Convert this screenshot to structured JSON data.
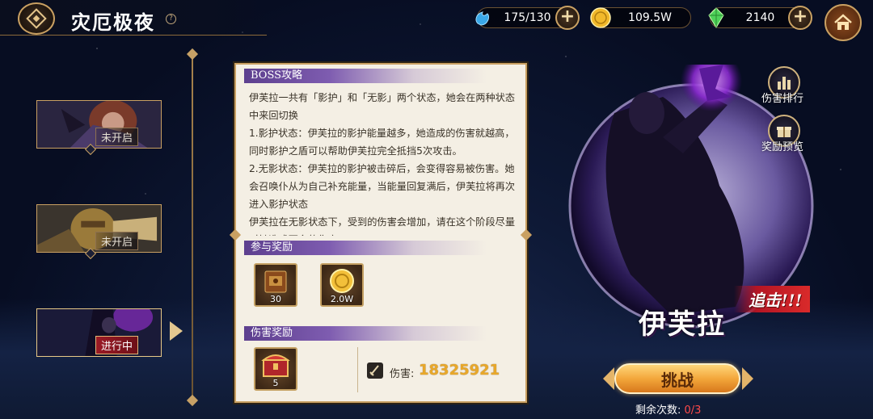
{
  "header": {
    "title": "灾厄极夜",
    "help_icon": "?"
  },
  "resources": [
    {
      "name": "stamina",
      "icon": "water-drop-icon",
      "value": "175/130"
    },
    {
      "name": "gold",
      "icon": "gold-coin-icon",
      "value": "109.5W"
    },
    {
      "name": "gems",
      "icon": "green-crystal-icon",
      "value": "2140"
    }
  ],
  "boss_list": [
    {
      "status": "未开启",
      "active": false
    },
    {
      "status": "未开启",
      "active": false
    },
    {
      "status": "进行中",
      "active": true
    }
  ],
  "panel": {
    "strategy_title": "BOSS攻略",
    "strategy_lines": [
      "伊芙拉一共有「影护」和「无影」两个状态，她会在两种状态中来回切换",
      "1.影护状态：伊芙拉的影护能量越多，她造成的伤害就越高，同时影护之盾可以帮助伊芙拉完全抵挡5次攻击。",
      "2.无影状态：伊芙拉的影护被击碎后，会变得容易被伤害。她会召唤仆从为自己补充能量，当能量回复满后，伊芙拉将再次进入影护状态",
      "伊芙拉在无影状态下，受到的伤害会增加，请在这个阶段尽量对她造成更多的伤害"
    ],
    "participation_title": "参与奖励",
    "participation_rewards": [
      {
        "icon": "scroll-box-icon",
        "count": "30"
      },
      {
        "icon": "gold-coin-icon",
        "count": "2.0W"
      }
    ],
    "damage_title": "伤害奖励",
    "damage_rewards": [
      {
        "icon": "treasure-chest-icon",
        "count": "5"
      }
    ],
    "damage_label": "伤害:",
    "damage_value": "18325921"
  },
  "right": {
    "rank_label": "伤害排行",
    "preview_label": "奖励预览",
    "boss_name": "伊芙拉",
    "chase_badge": "追击!!!",
    "challenge_label": "挑战",
    "remaining_label": "剩余次数:",
    "remaining_value": "0/3"
  },
  "colors": {
    "gold_frame": "#c9a062",
    "panel_bg": "#f4efe4",
    "section_purple": "#7e5cb0",
    "damage_value": "#e8a82a",
    "remaining_value": "#ff4a4a",
    "challenge_button": "#f3a73b"
  }
}
